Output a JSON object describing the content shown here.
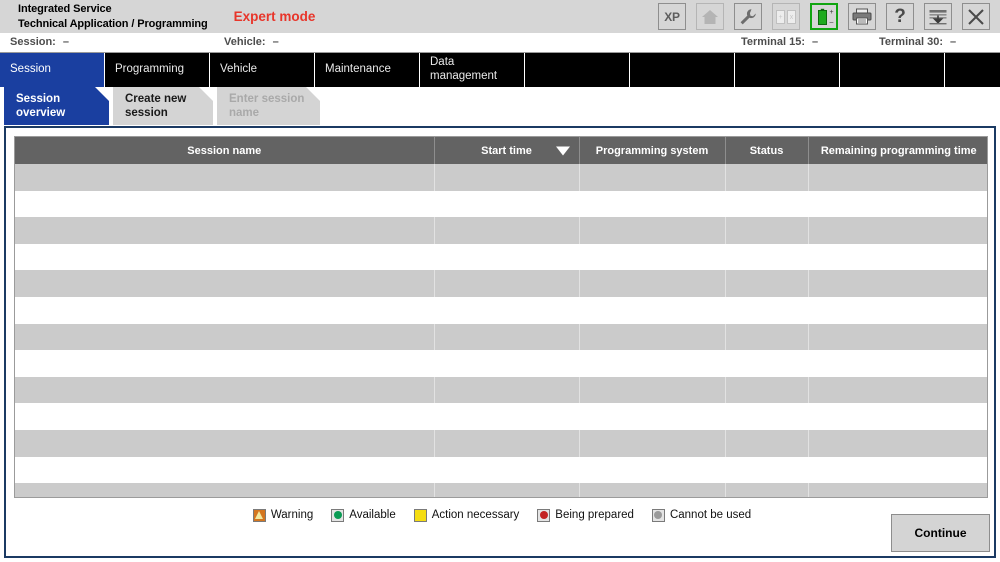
{
  "header": {
    "title_line1": "Integrated Service",
    "title_line2": "Technical Application / Programming",
    "mode_label": "Expert mode"
  },
  "toolbar": {
    "items": [
      {
        "name": "xp-button",
        "label": "XP",
        "state": "enabled"
      },
      {
        "name": "home-button",
        "label": "",
        "state": "disabled"
      },
      {
        "name": "settings-wrench-button",
        "label": "",
        "state": "enabled"
      },
      {
        "name": "compare-windows-button",
        "label": "",
        "state": "disabled"
      },
      {
        "name": "battery-status-button",
        "label": "",
        "state": "active"
      },
      {
        "name": "print-button",
        "label": "",
        "state": "enabled"
      },
      {
        "name": "help-button",
        "label": "?",
        "state": "enabled"
      },
      {
        "name": "download-button",
        "label": "",
        "state": "enabled"
      },
      {
        "name": "close-button",
        "label": "",
        "state": "enabled"
      }
    ]
  },
  "info_strip": {
    "session_label": "Session:",
    "session_value": "–",
    "vehicle_label": "Vehicle:",
    "vehicle_value": "–",
    "terminal15_label": "Terminal 15:",
    "terminal15_value": "–",
    "terminal30_label": "Terminal 30:",
    "terminal30_value": "–"
  },
  "main_tabs": [
    {
      "label": "Session",
      "selected": true
    },
    {
      "label": "Programming",
      "selected": false
    },
    {
      "label": "Vehicle",
      "selected": false
    },
    {
      "label": "Maintenance",
      "selected": false
    },
    {
      "label": "Data\nmanagement",
      "selected": false
    },
    {
      "label": "",
      "selected": false
    },
    {
      "label": "",
      "selected": false
    },
    {
      "label": "",
      "selected": false
    },
    {
      "label": "",
      "selected": false
    },
    {
      "label": "",
      "selected": false
    }
  ],
  "sub_tabs": [
    {
      "label": "Session\noverview",
      "state": "selected"
    },
    {
      "label": "Create new\nsession",
      "state": "normal"
    },
    {
      "label": "Enter session\nname",
      "state": "disabled"
    }
  ],
  "table": {
    "columns": [
      {
        "label": "Session name",
        "sorted": false
      },
      {
        "label": "Start time",
        "sorted": true
      },
      {
        "label": "Programming system",
        "sorted": false
      },
      {
        "label": "Status",
        "sorted": false
      },
      {
        "label": "Remaining programming time",
        "sorted": false
      }
    ],
    "rows": [
      {
        "session_name": "",
        "start_time": "",
        "programming_system": "",
        "status": "",
        "remaining_time": ""
      },
      {
        "session_name": "",
        "start_time": "",
        "programming_system": "",
        "status": "",
        "remaining_time": ""
      },
      {
        "session_name": "",
        "start_time": "",
        "programming_system": "",
        "status": "",
        "remaining_time": ""
      },
      {
        "session_name": "",
        "start_time": "",
        "programming_system": "",
        "status": "",
        "remaining_time": ""
      },
      {
        "session_name": "",
        "start_time": "",
        "programming_system": "",
        "status": "",
        "remaining_time": ""
      },
      {
        "session_name": "",
        "start_time": "",
        "programming_system": "",
        "status": "",
        "remaining_time": ""
      },
      {
        "session_name": "",
        "start_time": "",
        "programming_system": "",
        "status": "",
        "remaining_time": ""
      },
      {
        "session_name": "",
        "start_time": "",
        "programming_system": "",
        "status": "",
        "remaining_time": ""
      },
      {
        "session_name": "",
        "start_time": "",
        "programming_system": "",
        "status": "",
        "remaining_time": ""
      },
      {
        "session_name": "",
        "start_time": "",
        "programming_system": "",
        "status": "",
        "remaining_time": ""
      },
      {
        "session_name": "",
        "start_time": "",
        "programming_system": "",
        "status": "",
        "remaining_time": ""
      },
      {
        "session_name": "",
        "start_time": "",
        "programming_system": "",
        "status": "",
        "remaining_time": ""
      },
      {
        "session_name": "",
        "start_time": "",
        "programming_system": "",
        "status": "",
        "remaining_time": ""
      }
    ]
  },
  "legend": [
    {
      "label": "Warning",
      "icon": "warning-icon",
      "color": "#d4761f"
    },
    {
      "label": "Available",
      "icon": "available-icon",
      "color": "#0a9b54"
    },
    {
      "label": "Action necessary",
      "icon": "action-necessary-icon",
      "color": "#f5dd12"
    },
    {
      "label": "Being prepared",
      "icon": "being-prepared-icon",
      "color": "#c32323"
    },
    {
      "label": "Cannot be used",
      "icon": "cannot-be-used-icon",
      "color": "#9a9a9a"
    }
  ],
  "footer": {
    "continue_label": "Continue"
  },
  "colors": {
    "accent_blue": "#1a3fa0",
    "panel_border": "#1b3a63",
    "header_bg": "#d6d6d6",
    "tab_bg": "#000000",
    "table_header_bg": "#636363",
    "row_alt_bg": "#cbcbcb",
    "expert_mode_red": "#e8352a",
    "battery_green": "#11a511"
  }
}
